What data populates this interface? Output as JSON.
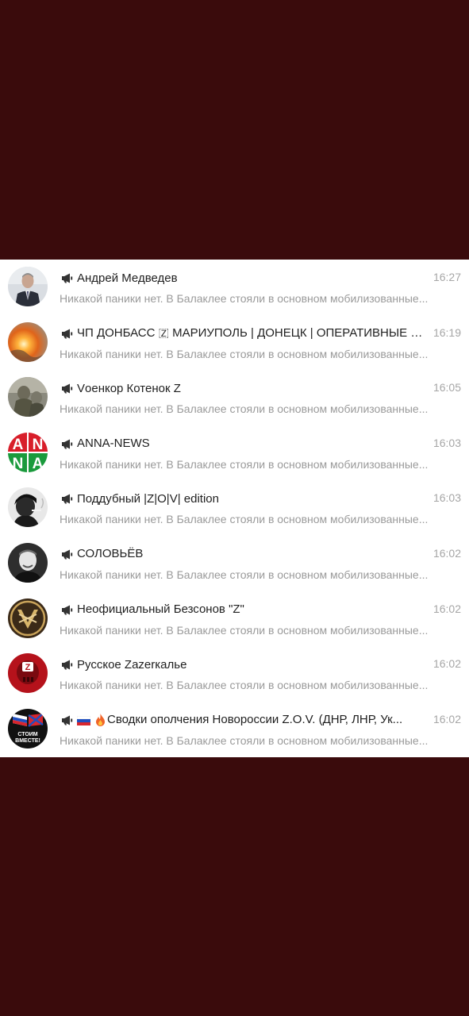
{
  "chats": [
    {
      "title": "Андрей Медведев",
      "time": "16:27",
      "preview": "Никакой паники нет. В Балаклее стояли в основном мобилизованные...",
      "avatar": "person-suit-avatar"
    },
    {
      "title": "ЧП ДОНБАСС 🇿 МАРИУПОЛЬ | ДОНЕЦК | ОПЕРАТИВНЫЕ С...",
      "time": "16:19",
      "preview": "Никакой паники нет. В Балаклее стояли в основном мобилизованные...",
      "avatar": "explosion-avatar"
    },
    {
      "title": "Vоенкор Котенок Z",
      "time": "16:05",
      "preview": "Никакой паники нет. В Балаклее стояли в основном мобилизованные...",
      "avatar": "soldier-avatar"
    },
    {
      "title": "ANNA-NEWS",
      "time": "16:03",
      "preview": "Никакой паники нет. В Балаклее стояли в основном мобилизованные...",
      "avatar": "anna-news-logo-avatar",
      "logo_letters": [
        "A",
        "N",
        "N",
        "A"
      ]
    },
    {
      "title": "Поддубный |Z|O|V| edition",
      "time": "16:03",
      "preview": "Никакой паники нет. В Балаклее стояли в основном мобилизованные...",
      "avatar": "person-smoking-avatar"
    },
    {
      "title": "СОЛОВЬЁВ",
      "time": "16:02",
      "preview": "Никакой паники нет. В Балаклее стояли в основном мобилизованные...",
      "avatar": "man-portrait-avatar"
    },
    {
      "title": "Неофициальный Безсонов \"Z\"",
      "time": "16:02",
      "preview": "Никакой паники нет. В Балаклее стояли в основном мобилизованные...",
      "avatar": "gold-emblem-avatar"
    },
    {
      "title": "Русское Zazerкалье",
      "time": "16:02",
      "preview": "Никакой паники нет. В Балаклее стояли в основном мобилизованные...",
      "avatar": "red-skull-avatar",
      "logo_letter": "Z"
    },
    {
      "title": "Сводки ополчения Новороссии Z.O.V. (ДНР, ЛНР, Ук...",
      "time": "16:02",
      "preview": "Никакой паники нет. В Балаклее стояли в основном мобилизованные...",
      "avatar": "flags-avatar",
      "logo_text": [
        "СТОИМ",
        "ВМЕСТЕ!"
      ],
      "prefix_icons": [
        "russian-flag-icon",
        "fire-icon"
      ]
    }
  ],
  "colors": {
    "background": "#3a0b0c",
    "list_background": "#ffffff",
    "title": "#1f1f1f",
    "time": "#a6a6a6",
    "preview": "#9a9a9a"
  }
}
